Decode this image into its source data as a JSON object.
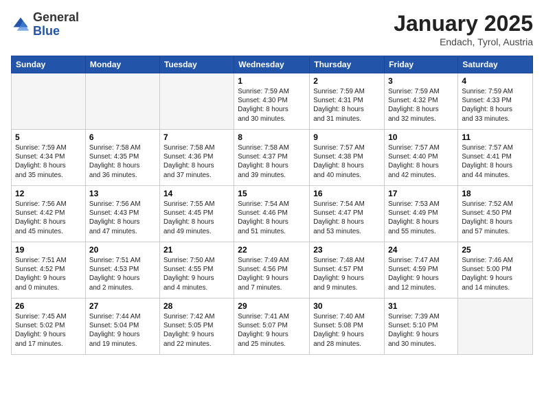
{
  "header": {
    "logo_general": "General",
    "logo_blue": "Blue",
    "month": "January 2025",
    "location": "Endach, Tyrol, Austria"
  },
  "weekdays": [
    "Sunday",
    "Monday",
    "Tuesday",
    "Wednesday",
    "Thursday",
    "Friday",
    "Saturday"
  ],
  "weeks": [
    [
      {
        "day": "",
        "info": "",
        "empty": true
      },
      {
        "day": "",
        "info": "",
        "empty": true
      },
      {
        "day": "",
        "info": "",
        "empty": true
      },
      {
        "day": "1",
        "info": "Sunrise: 7:59 AM\nSunset: 4:30 PM\nDaylight: 8 hours\nand 30 minutes.",
        "empty": false
      },
      {
        "day": "2",
        "info": "Sunrise: 7:59 AM\nSunset: 4:31 PM\nDaylight: 8 hours\nand 31 minutes.",
        "empty": false
      },
      {
        "day": "3",
        "info": "Sunrise: 7:59 AM\nSunset: 4:32 PM\nDaylight: 8 hours\nand 32 minutes.",
        "empty": false
      },
      {
        "day": "4",
        "info": "Sunrise: 7:59 AM\nSunset: 4:33 PM\nDaylight: 8 hours\nand 33 minutes.",
        "empty": false
      }
    ],
    [
      {
        "day": "5",
        "info": "Sunrise: 7:59 AM\nSunset: 4:34 PM\nDaylight: 8 hours\nand 35 minutes.",
        "empty": false
      },
      {
        "day": "6",
        "info": "Sunrise: 7:58 AM\nSunset: 4:35 PM\nDaylight: 8 hours\nand 36 minutes.",
        "empty": false
      },
      {
        "day": "7",
        "info": "Sunrise: 7:58 AM\nSunset: 4:36 PM\nDaylight: 8 hours\nand 37 minutes.",
        "empty": false
      },
      {
        "day": "8",
        "info": "Sunrise: 7:58 AM\nSunset: 4:37 PM\nDaylight: 8 hours\nand 39 minutes.",
        "empty": false
      },
      {
        "day": "9",
        "info": "Sunrise: 7:57 AM\nSunset: 4:38 PM\nDaylight: 8 hours\nand 40 minutes.",
        "empty": false
      },
      {
        "day": "10",
        "info": "Sunrise: 7:57 AM\nSunset: 4:40 PM\nDaylight: 8 hours\nand 42 minutes.",
        "empty": false
      },
      {
        "day": "11",
        "info": "Sunrise: 7:57 AM\nSunset: 4:41 PM\nDaylight: 8 hours\nand 44 minutes.",
        "empty": false
      }
    ],
    [
      {
        "day": "12",
        "info": "Sunrise: 7:56 AM\nSunset: 4:42 PM\nDaylight: 8 hours\nand 45 minutes.",
        "empty": false
      },
      {
        "day": "13",
        "info": "Sunrise: 7:56 AM\nSunset: 4:43 PM\nDaylight: 8 hours\nand 47 minutes.",
        "empty": false
      },
      {
        "day": "14",
        "info": "Sunrise: 7:55 AM\nSunset: 4:45 PM\nDaylight: 8 hours\nand 49 minutes.",
        "empty": false
      },
      {
        "day": "15",
        "info": "Sunrise: 7:54 AM\nSunset: 4:46 PM\nDaylight: 8 hours\nand 51 minutes.",
        "empty": false
      },
      {
        "day": "16",
        "info": "Sunrise: 7:54 AM\nSunset: 4:47 PM\nDaylight: 8 hours\nand 53 minutes.",
        "empty": false
      },
      {
        "day": "17",
        "info": "Sunrise: 7:53 AM\nSunset: 4:49 PM\nDaylight: 8 hours\nand 55 minutes.",
        "empty": false
      },
      {
        "day": "18",
        "info": "Sunrise: 7:52 AM\nSunset: 4:50 PM\nDaylight: 8 hours\nand 57 minutes.",
        "empty": false
      }
    ],
    [
      {
        "day": "19",
        "info": "Sunrise: 7:51 AM\nSunset: 4:52 PM\nDaylight: 9 hours\nand 0 minutes.",
        "empty": false
      },
      {
        "day": "20",
        "info": "Sunrise: 7:51 AM\nSunset: 4:53 PM\nDaylight: 9 hours\nand 2 minutes.",
        "empty": false
      },
      {
        "day": "21",
        "info": "Sunrise: 7:50 AM\nSunset: 4:55 PM\nDaylight: 9 hours\nand 4 minutes.",
        "empty": false
      },
      {
        "day": "22",
        "info": "Sunrise: 7:49 AM\nSunset: 4:56 PM\nDaylight: 9 hours\nand 7 minutes.",
        "empty": false
      },
      {
        "day": "23",
        "info": "Sunrise: 7:48 AM\nSunset: 4:57 PM\nDaylight: 9 hours\nand 9 minutes.",
        "empty": false
      },
      {
        "day": "24",
        "info": "Sunrise: 7:47 AM\nSunset: 4:59 PM\nDaylight: 9 hours\nand 12 minutes.",
        "empty": false
      },
      {
        "day": "25",
        "info": "Sunrise: 7:46 AM\nSunset: 5:00 PM\nDaylight: 9 hours\nand 14 minutes.",
        "empty": false
      }
    ],
    [
      {
        "day": "26",
        "info": "Sunrise: 7:45 AM\nSunset: 5:02 PM\nDaylight: 9 hours\nand 17 minutes.",
        "empty": false
      },
      {
        "day": "27",
        "info": "Sunrise: 7:44 AM\nSunset: 5:04 PM\nDaylight: 9 hours\nand 19 minutes.",
        "empty": false
      },
      {
        "day": "28",
        "info": "Sunrise: 7:42 AM\nSunset: 5:05 PM\nDaylight: 9 hours\nand 22 minutes.",
        "empty": false
      },
      {
        "day": "29",
        "info": "Sunrise: 7:41 AM\nSunset: 5:07 PM\nDaylight: 9 hours\nand 25 minutes.",
        "empty": false
      },
      {
        "day": "30",
        "info": "Sunrise: 7:40 AM\nSunset: 5:08 PM\nDaylight: 9 hours\nand 28 minutes.",
        "empty": false
      },
      {
        "day": "31",
        "info": "Sunrise: 7:39 AM\nSunset: 5:10 PM\nDaylight: 9 hours\nand 30 minutes.",
        "empty": false
      },
      {
        "day": "",
        "info": "",
        "empty": true
      }
    ]
  ]
}
